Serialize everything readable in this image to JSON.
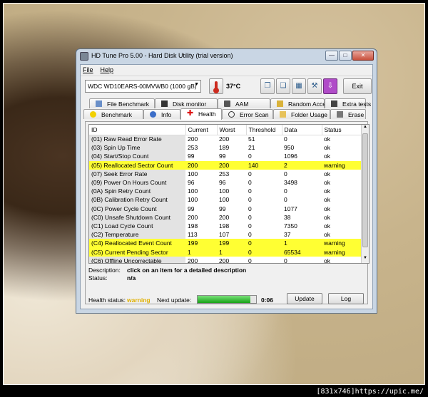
{
  "window": {
    "title": "HD Tune Pro 5.00 - Hard Disk Utility (trial version)"
  },
  "menu": [
    "File",
    "Help"
  ],
  "toolbar": {
    "drive": "WDC WD10EARS-00MVWB0 (1000 gB)",
    "temperature": "37°C",
    "exit_label": "Exit"
  },
  "tabs_top": [
    "File Benchmark",
    "Disk monitor",
    "AAM",
    "Random Access",
    "Extra tests"
  ],
  "tabs_bottom": [
    "Benchmark",
    "Info",
    "Health",
    "Error Scan",
    "Folder Usage",
    "Erase"
  ],
  "active_tab": "Health",
  "table": {
    "headers": [
      "ID",
      "Current",
      "Worst",
      "Threshold",
      "Data",
      "Status"
    ],
    "rows": [
      [
        "(01) Raw Read Error Rate",
        "200",
        "200",
        "51",
        "0",
        "ok"
      ],
      [
        "(03) Spin Up Time",
        "253",
        "189",
        "21",
        "950",
        "ok"
      ],
      [
        "(04) Start/Stop Count",
        "99",
        "99",
        "0",
        "1096",
        "ok"
      ],
      [
        "(05) Reallocated Sector Count",
        "200",
        "200",
        "140",
        "2",
        "warning"
      ],
      [
        "(07) Seek Error Rate",
        "100",
        "253",
        "0",
        "0",
        "ok"
      ],
      [
        "(09) Power On Hours Count",
        "96",
        "96",
        "0",
        "3498",
        "ok"
      ],
      [
        "(0A) Spin Retry Count",
        "100",
        "100",
        "0",
        "0",
        "ok"
      ],
      [
        "(0B) Calibration Retry Count",
        "100",
        "100",
        "0",
        "0",
        "ok"
      ],
      [
        "(0C) Power Cycle Count",
        "99",
        "99",
        "0",
        "1077",
        "ok"
      ],
      [
        "(C0) Unsafe Shutdown Count",
        "200",
        "200",
        "0",
        "38",
        "ok"
      ],
      [
        "(C1) Load Cycle Count",
        "198",
        "198",
        "0",
        "7350",
        "ok"
      ],
      [
        "(C2) Temperature",
        "113",
        "107",
        "0",
        "37",
        "ok"
      ],
      [
        "(C4) Reallocated Event Count",
        "199",
        "199",
        "0",
        "1",
        "warning"
      ],
      [
        "(C5) Current Pending Sector",
        "1",
        "1",
        "0",
        "65534",
        "warning"
      ],
      [
        "(C6) Offline Uncorrectable",
        "200",
        "200",
        "0",
        "0",
        "ok"
      ]
    ]
  },
  "description": {
    "label": "Description:",
    "value": "click on an item for a detailed description"
  },
  "status": {
    "label": "Status:",
    "value": "n/a"
  },
  "health": {
    "label": "Health status:",
    "value": "warning",
    "next_label": "Next update:",
    "progress": 0.9,
    "time": "0:06",
    "update_label": "Update",
    "log_label": "Log"
  },
  "watermark": "[831x746]https://upic.me/",
  "colors": {
    "warning_row": "#ffff33",
    "warning_text": "#e0b000",
    "progress": "#16a316"
  }
}
